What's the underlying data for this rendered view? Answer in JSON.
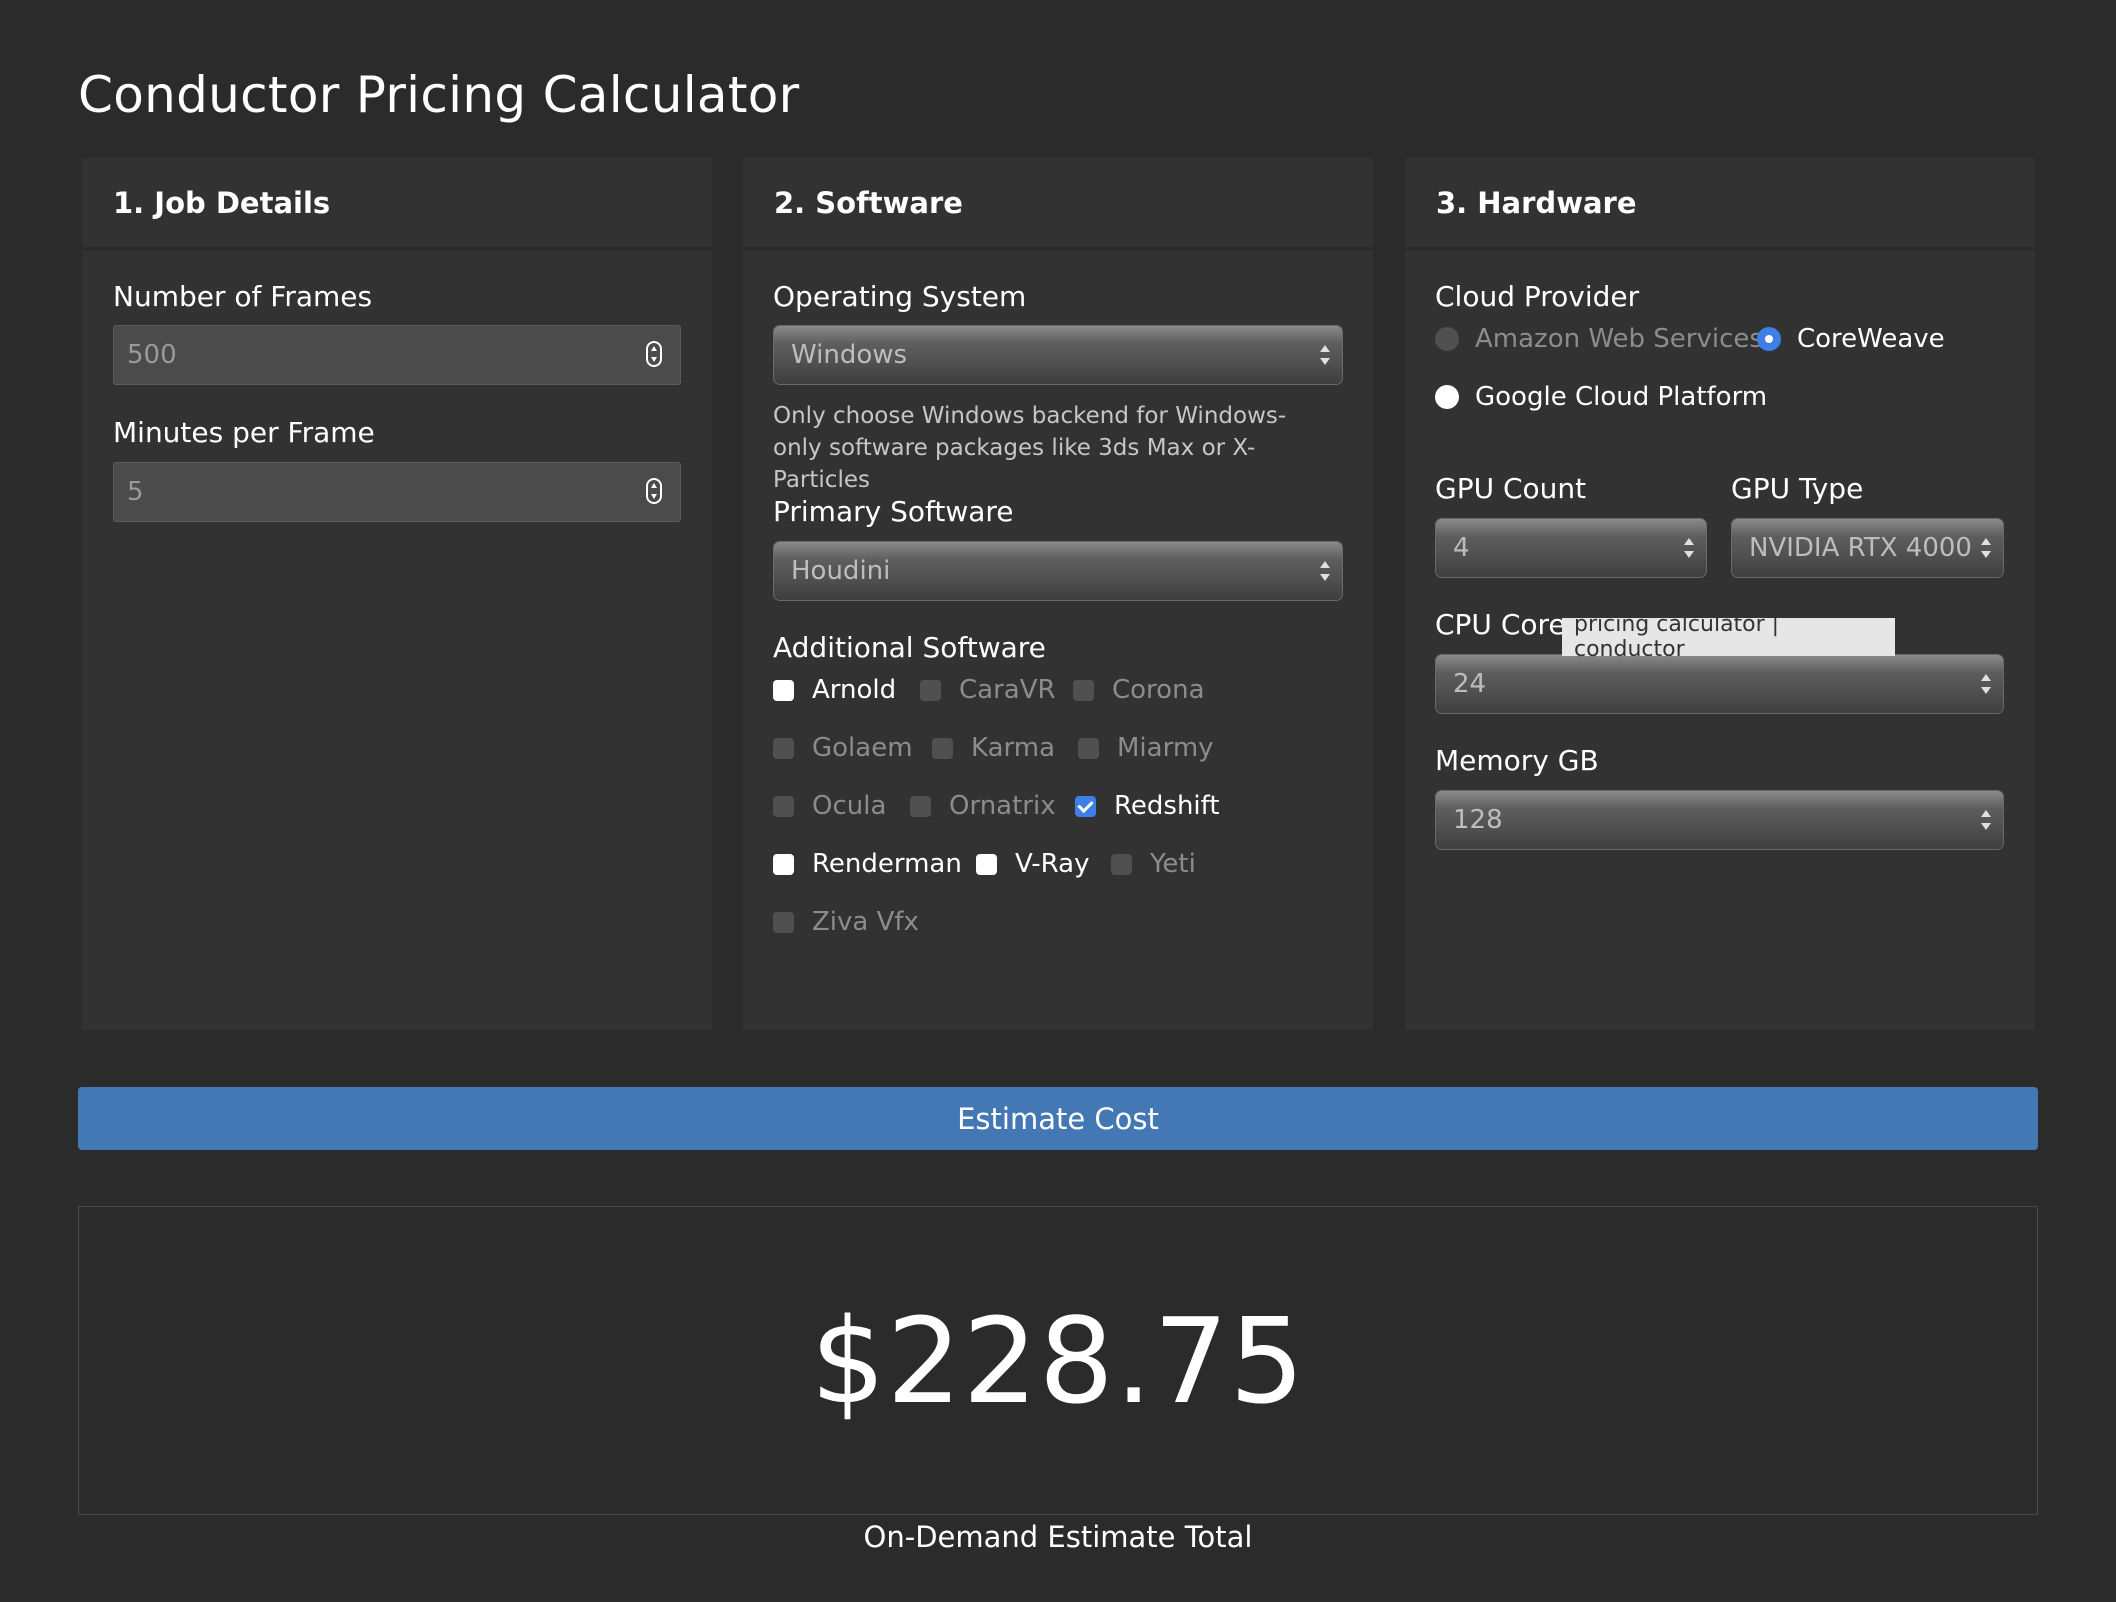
{
  "page": {
    "title": "Conductor Pricing Calculator"
  },
  "job_details": {
    "header": "1. Job Details",
    "frames_label": "Number of Frames",
    "frames_value": "500",
    "minutes_label": "Minutes per Frame",
    "minutes_value": "5"
  },
  "software": {
    "header": "2. Software",
    "os_label": "Operating System",
    "os_value": "Windows",
    "os_hint": "Only choose Windows backend for Windows-only software packages like 3ds Max or X-Particles",
    "primary_label": "Primary Software",
    "primary_value": "Houdini",
    "additional_label": "Additional Software",
    "additional": [
      {
        "label": "Arnold",
        "state": "unchecked"
      },
      {
        "label": "CaraVR",
        "state": "disabled"
      },
      {
        "label": "Corona",
        "state": "disabled"
      },
      {
        "label": "Golaem",
        "state": "disabled"
      },
      {
        "label": "Karma",
        "state": "disabled"
      },
      {
        "label": "Miarmy",
        "state": "disabled"
      },
      {
        "label": "Ocula",
        "state": "disabled"
      },
      {
        "label": "Ornatrix",
        "state": "disabled"
      },
      {
        "label": "Redshift",
        "state": "checked"
      },
      {
        "label": "Renderman",
        "state": "unchecked"
      },
      {
        "label": "V-Ray",
        "state": "unchecked"
      },
      {
        "label": "Yeti",
        "state": "disabled"
      },
      {
        "label": "Ziva Vfx",
        "state": "disabled"
      }
    ]
  },
  "hardware": {
    "header": "3. Hardware",
    "provider_label": "Cloud Provider",
    "providers": [
      {
        "label": "Amazon Web Services",
        "state": "disabled"
      },
      {
        "label": "CoreWeave",
        "state": "selected"
      },
      {
        "label": "Google Cloud Platform",
        "state": "unselected"
      }
    ],
    "gpu_count_label": "GPU Count",
    "gpu_count_value": "4",
    "gpu_type_label": "GPU Type",
    "gpu_type_value": "NVIDIA RTX 4000",
    "cpu_label": "CPU Cores",
    "cpu_value": "24",
    "memory_label": "Memory GB",
    "memory_value": "128"
  },
  "tooltip": {
    "text": "pricing calculator | conductor"
  },
  "action": {
    "estimate_label": "Estimate Cost"
  },
  "result": {
    "value": "$228.75",
    "caption": "On-Demand Estimate Total"
  },
  "colors": {
    "background": "#2b2b2b",
    "panel": "#323232",
    "accent": "#4478b4",
    "check": "#3d7fe6"
  }
}
